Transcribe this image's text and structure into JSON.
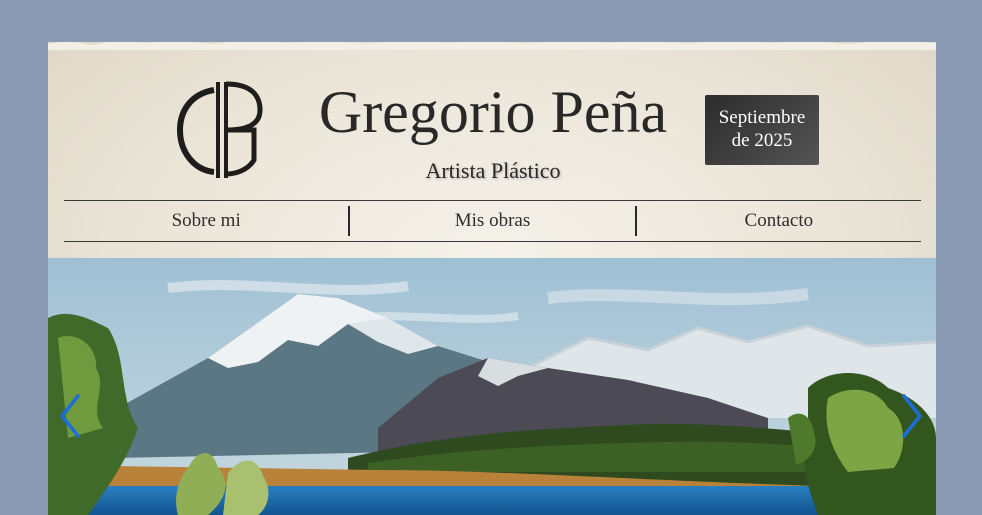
{
  "header": {
    "monogram": "GP",
    "title": "Gregorio Peña",
    "subtitle": "Artista Plástico",
    "date_line1": "Septiembre",
    "date_line2": "de 2025"
  },
  "nav": {
    "items": [
      {
        "label": "Sobre mi"
      },
      {
        "label": "Mis obras"
      },
      {
        "label": "Contacto"
      }
    ]
  },
  "slider": {
    "image_icon": "mountain-lake-painting",
    "prev_icon": "chevron-left-icon",
    "next_icon": "chevron-right-icon"
  },
  "colors": {
    "background": "#8a9bb3",
    "paper": "#efebe2",
    "text": "#2a2827",
    "badge": "#333333",
    "arrow": "#1a6fd8"
  }
}
